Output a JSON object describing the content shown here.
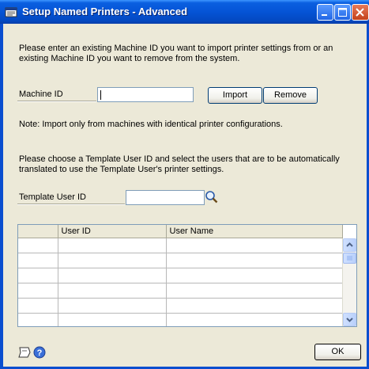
{
  "window": {
    "title": "Setup Named Printers - Advanced"
  },
  "intro": {
    "text": "Please enter an existing Machine ID you want to import printer settings from or an existing Machine ID you want to remove from the system."
  },
  "machine": {
    "label": "Machine ID",
    "value": "",
    "import_label": "Import",
    "remove_label": "Remove"
  },
  "note": {
    "text": "Note: Import only from machines with identical printer configurations."
  },
  "template": {
    "text": "Please choose a Template User ID and select the users that are to be automatically translated to use the Template User's printer settings.",
    "label": "Template User ID",
    "value": ""
  },
  "grid": {
    "columns": [
      "",
      "User ID",
      "User Name"
    ],
    "rows": [
      [
        "",
        "",
        ""
      ],
      [
        "",
        "",
        ""
      ],
      [
        "",
        "",
        ""
      ],
      [
        "",
        "",
        ""
      ],
      [
        "",
        "",
        ""
      ],
      [
        "",
        "",
        ""
      ]
    ]
  },
  "footer": {
    "ok_label": "OK"
  }
}
